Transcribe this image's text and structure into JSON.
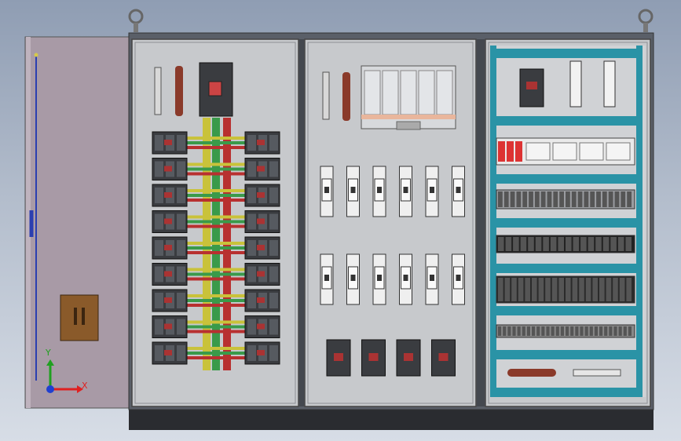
{
  "viewport": {
    "background_top": "#8f9db3",
    "background_bottom": "#d7dde6"
  },
  "colors": {
    "cabinet_frame": "#5a5f68",
    "mounting_plate": "#c7c9cc",
    "plinth": "#2a2c30",
    "door": "#a89aa6",
    "din_rail_teal": "#2a93a6",
    "busbar_yellow": "#c9c23a",
    "busbar_green": "#3a9a4a",
    "busbar_red": "#b83030",
    "copper": "#8a3a2a",
    "breaker_body": "#3a3c40",
    "axis_x": "#e02020",
    "axis_y": "#20a020",
    "axis_z": "#2040d0"
  },
  "icons": {
    "lifting_eye": "lifting-eye-icon",
    "coordinate_triad": "coordinate-triad-icon"
  },
  "layout": {
    "left_section_breaker_rows": 9,
    "middle_section_fuse_rows": 2,
    "middle_section_fuses_per_row": 6,
    "middle_section_bottom_breakers": 4
  },
  "axis": {
    "x_label": "X",
    "y_label": "Y"
  }
}
